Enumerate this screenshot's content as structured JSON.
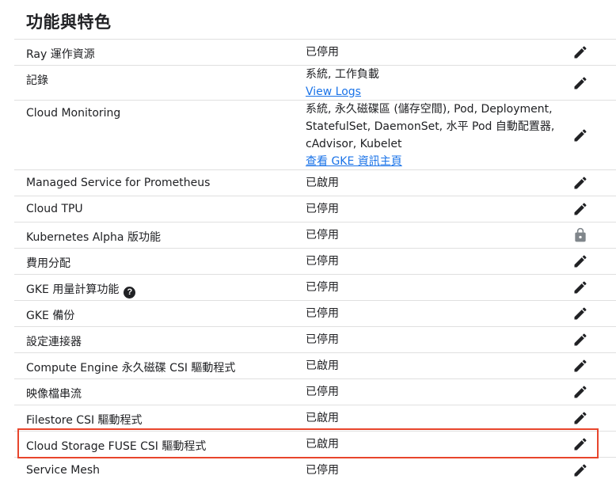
{
  "section": {
    "title": "功能與特色"
  },
  "rows": [
    {
      "label": "Ray 運作資源",
      "value": "已停用",
      "action": "edit-icon"
    },
    {
      "label": "記錄",
      "value": "系統, 工作負載",
      "link": "View Logs",
      "action": "edit-icon"
    },
    {
      "label": "Cloud Monitoring",
      "value_lines": [
        "系統, 永久磁碟區 (儲存空間), Pod, Deployment,",
        "StatefulSet, DaemonSet, 水平 Pod 自動配置器,",
        "cAdvisor, Kubelet"
      ],
      "link": "查看 GKE 資訊主頁",
      "action": "edit-icon"
    },
    {
      "label": "Managed Service for Prometheus",
      "value": "已啟用",
      "action": "edit-icon"
    },
    {
      "label": "Cloud TPU",
      "value": "已停用",
      "action": "edit-icon"
    },
    {
      "label": "Kubernetes Alpha 版功能",
      "value": "已停用",
      "action": "lock-icon"
    },
    {
      "label": "費用分配",
      "value": "已停用",
      "action": "edit-icon"
    },
    {
      "label": "GKE 用量計算功能",
      "value": "已停用",
      "action": "edit-icon",
      "help_icon": "?"
    },
    {
      "label": "GKE 備份",
      "value": "已停用",
      "action": "edit-icon"
    },
    {
      "label": "設定連接器",
      "value": "已停用",
      "action": "edit-icon"
    },
    {
      "label": "Compute Engine 永久磁碟 CSI 驅動程式",
      "value": "已啟用",
      "action": "edit-icon"
    },
    {
      "label": "映像檔串流",
      "value": "已停用",
      "action": "edit-icon"
    },
    {
      "label": "Filestore CSI 驅動程式",
      "value": "已啟用",
      "action": "edit-icon"
    },
    {
      "label": "Cloud Storage FUSE CSI 驅動程式",
      "value": "已啟用",
      "action": "edit-icon",
      "highlighted": true
    },
    {
      "label": "Service Mesh",
      "value": "已停用",
      "action": "edit-icon"
    }
  ],
  "colors": {
    "link": "#1a73e8",
    "highlight": "#e8452c",
    "divider": "#e0e0e0"
  }
}
